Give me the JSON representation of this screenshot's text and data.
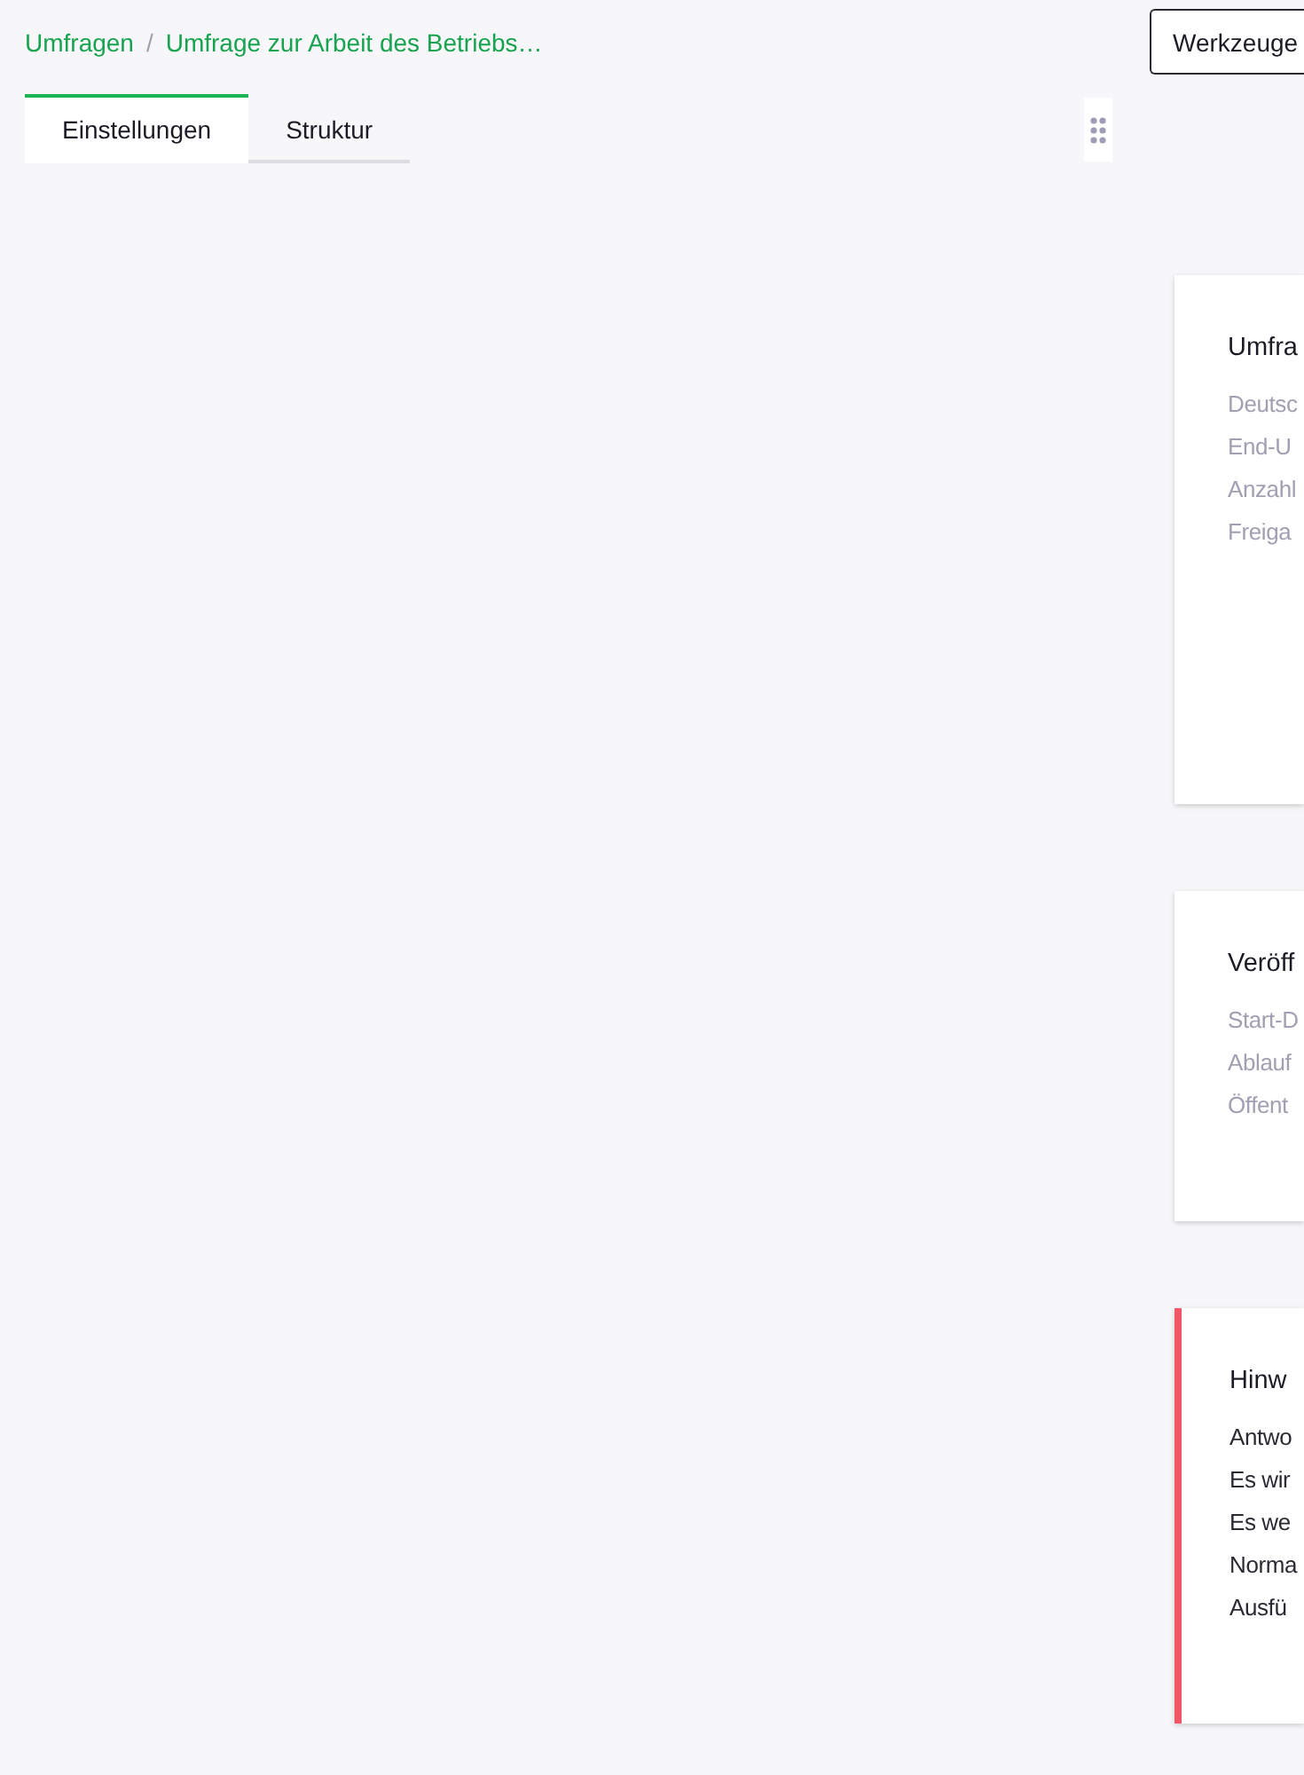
{
  "breadcrumb": {
    "items": [
      {
        "label": "Umfragen"
      },
      {
        "label": "Umfrage zur Arbeit des Betriebs…"
      }
    ],
    "separator": "/"
  },
  "toolbar": {
    "button": "Werkzeuge"
  },
  "tabs": [
    {
      "label": "Einstellungen",
      "selected": true
    },
    {
      "label": "Struktur",
      "selected": false
    }
  ],
  "cards": [
    {
      "kind": "info",
      "title": "Umfra",
      "lines": [
        "Deutsc",
        "End-U",
        "Anzahl",
        "Freiga"
      ]
    },
    {
      "kind": "info",
      "title": "Veröff",
      "lines": [
        "Start-D",
        "Ablauf",
        "Öffent"
      ]
    },
    {
      "kind": "alert",
      "title": "Hinw",
      "lines": [
        "Antwo",
        "Es wir",
        "Es we",
        "Norma",
        "Ausfü"
      ]
    }
  ]
}
